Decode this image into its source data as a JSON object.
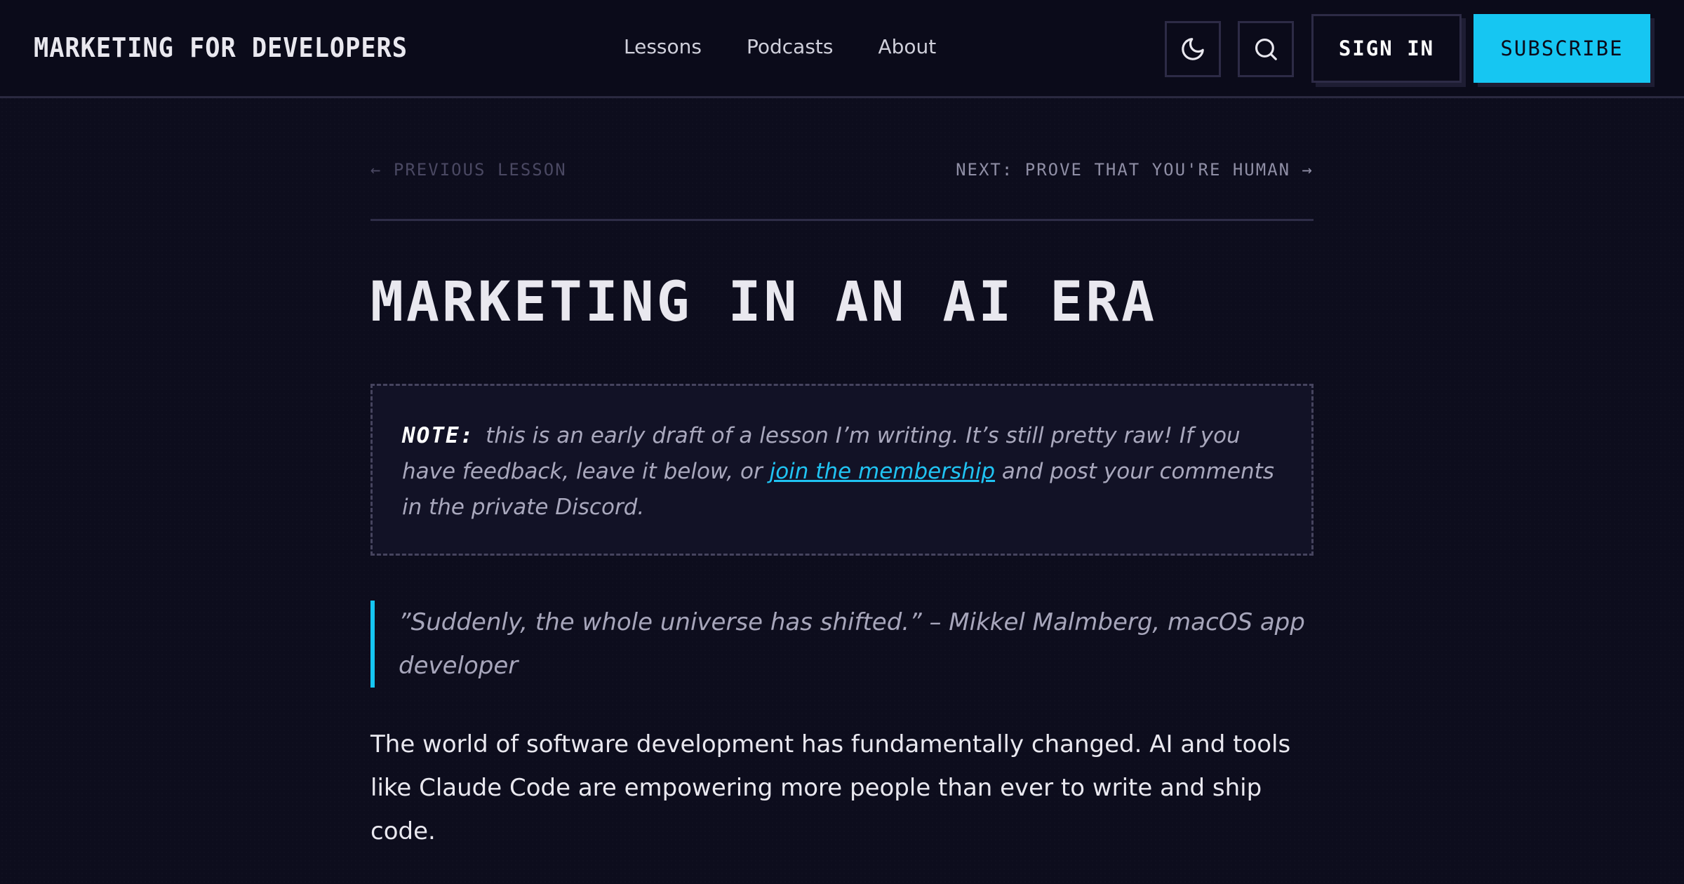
{
  "site": {
    "logo": "MARKETING FOR DEVELOPERS"
  },
  "nav": {
    "items": [
      "Lessons",
      "Podcasts",
      "About"
    ]
  },
  "header_actions": {
    "theme_icon": "moon-icon",
    "search_icon": "search-icon",
    "sign_in_label": "SIGN IN",
    "subscribe_label": "SUBSCRIBE"
  },
  "lesson_nav": {
    "prev_label": "← PREVIOUS LESSON",
    "next_label": "NEXT: PROVE THAT YOU'RE HUMAN →"
  },
  "article": {
    "title": "MARKETING IN AN AI ERA",
    "note": {
      "label": "NOTE:",
      "text_before": " this is an early draft of a lesson I’m writing. It’s still pretty raw! If you have feedback, leave it below, or ",
      "link_text": "join the membership",
      "text_after": " and post your comments in the private Discord."
    },
    "quote": "”Suddenly, the whole universe has shifted.” – Mikkel Malmberg, macOS app developer",
    "paragraph": "The world of software development has fundamentally changed. AI and tools like Claude Code are empowering more people than ever to write and ship code."
  },
  "colors": {
    "background": "#0d0d1d",
    "accent": "#16c6f2",
    "text": "#e9e8ef",
    "muted": "#a9a8bd"
  }
}
